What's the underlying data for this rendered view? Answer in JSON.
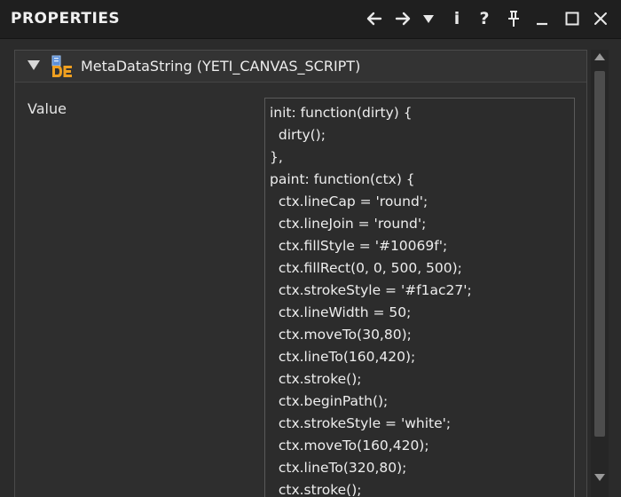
{
  "window": {
    "title": "PROPERTIES",
    "toolbar": {
      "back_icon": "arrow-left-icon",
      "forward_icon": "arrow-right-icon",
      "menu_icon": "triangle-down-icon",
      "info_label": "i",
      "help_label": "?",
      "pin_icon": "pin-icon",
      "minimize_icon": "minimize-icon",
      "maximize_icon": "maximize-icon",
      "close_icon": "close-icon"
    }
  },
  "section": {
    "title": "MetaDataString (YETI_CANVAS_SCRIPT)",
    "icon": "de-icon",
    "expanded": true,
    "property": {
      "label": "Value",
      "code_lines": [
        "init: function(dirty) {",
        "  dirty();",
        "},",
        "paint: function(ctx) {",
        "  ctx.lineCap = 'round';",
        "  ctx.lineJoin = 'round';",
        "  ctx.fillStyle = '#10069f';",
        "  ctx.fillRect(0, 0, 500, 500);",
        "  ctx.strokeStyle = '#f1ac27';",
        "  ctx.lineWidth = 50;",
        "  ctx.moveTo(30,80);",
        "  ctx.lineTo(160,420);",
        "  ctx.stroke();",
        "  ctx.beginPath();",
        "  ctx.strokeStyle = 'white';",
        "  ctx.moveTo(160,420);",
        "  ctx.lineTo(320,80);",
        "  ctx.stroke();"
      ]
    }
  },
  "colors": {
    "titlebar_bg": "#1f1f1f",
    "panel_bg": "#2b2b2b",
    "text": "#ededed",
    "icon_orange": "#f0a020",
    "icon_blue": "#4a7fd0"
  }
}
